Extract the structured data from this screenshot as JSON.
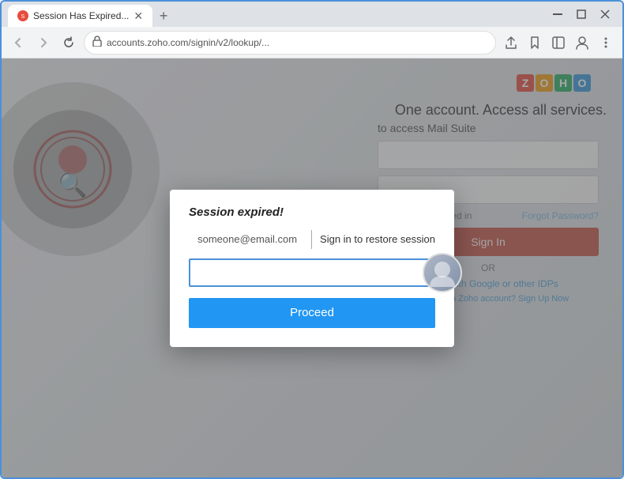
{
  "browser": {
    "tab": {
      "title": "Session Has Expired...",
      "favicon": "●"
    },
    "new_tab_label": "+",
    "window_controls": {
      "minimize": "—",
      "maximize": "□",
      "close": "✕"
    },
    "address_bar": {
      "url": "accounts.zoho.com/signin/v2/lookup/...",
      "lock_icon": "🔒"
    },
    "toolbar": {
      "share_icon": "⬆",
      "bookmark_icon": "☆",
      "sidebar_icon": "▣",
      "profile_icon": "👤",
      "menu_icon": "⋮"
    },
    "nav": {
      "back": "←",
      "forward": "→",
      "refresh": "↻"
    }
  },
  "background_page": {
    "zoho_logo_letters": [
      "Z",
      "O",
      "H",
      "O"
    ],
    "tagline": "One account. Access all services.",
    "form_label": "to access Mail Suite",
    "keep_signed": "Keep me signed in",
    "forgot_password": "Forgot Password?",
    "sign_in_btn": "Sign In",
    "or_text": "OR",
    "google_link": "Sign in with Google or other IDPs",
    "signup_text": "Don't have a Zoho account?",
    "signup_link": "Sign Up Now"
  },
  "dialog": {
    "title": "Session expired!",
    "email": "someone@email.com",
    "restore_text": "Sign in to restore session",
    "password_placeholder": "",
    "proceed_btn": "Proceed"
  }
}
